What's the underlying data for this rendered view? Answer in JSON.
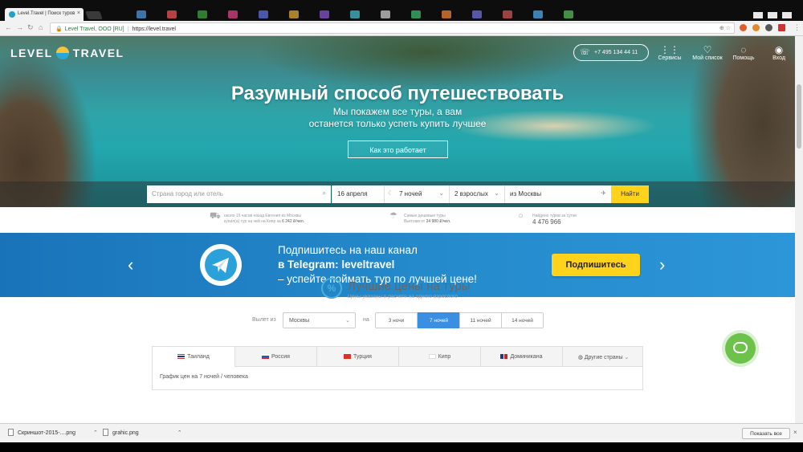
{
  "browser": {
    "tab_title": "Level.Travel | Поиск туров",
    "tab_close": "×",
    "org_name": "Level Travel, OOO [RU]",
    "url": "https://level.travel"
  },
  "header": {
    "logo_left": "LEVEL",
    "logo_right": "TRAVEL",
    "phone": "+7 495 134 44 11",
    "nav": [
      {
        "label": "Сервисы",
        "icon": "grid-icon"
      },
      {
        "label": "Мой список",
        "icon": "heart-icon"
      },
      {
        "label": "Помощь",
        "icon": "bulb-icon"
      },
      {
        "label": "Вход",
        "icon": "user-icon"
      }
    ]
  },
  "hero": {
    "title": "Разумный способ путешествовать",
    "subtitle_line1": "Мы покажем все туры, а вам",
    "subtitle_line2": "останется только успеть купить лучшее",
    "how_button": "Как это работает"
  },
  "search": {
    "destination_placeholder": "Страна город или отель",
    "date": "16 апреля",
    "nights": "7 ночей",
    "travelers": "2 взрослых",
    "from": "из Москвы",
    "find_button": "Найти"
  },
  "stats": [
    {
      "line1": "около 15 часов назад Евгения из Москвы",
      "line2": "купил(а) тур на чей на Кипр за",
      "value": "6 242 ₽/чел."
    },
    {
      "line1": "Самые дешевые туры",
      "line2": "Вьетнам от",
      "value": "24 980 ₽/чел."
    },
    {
      "line1": "Найдено туров за сутки",
      "line2": "",
      "value": "4 476 966"
    }
  ],
  "telegram": {
    "line1": "Подпишитесь на наш канал",
    "line2": "в Telegram: leveltravel",
    "line3": "– успейте поймать тур по лучшей цене!",
    "button": "Подпишитесь",
    "prev": "‹",
    "next": "›"
  },
  "best_prices": {
    "icon_glyph": "%",
    "title": "Лучшие цены на туры",
    "subtitle": "Цены указаны в расчете на одного взрослого",
    "from_label": "Вылет из",
    "from_value": "Москвы",
    "on_label": "на",
    "nights_options": [
      "3 ночи",
      "7 ночей",
      "11 ночей",
      "14 ночей"
    ],
    "active_nights": "7 ночей",
    "countries": [
      "Таиланд",
      "Россия",
      "Турция",
      "Кипр",
      "Доминикана",
      "Другие страны"
    ],
    "chart_caption": "График цен на 7 ночей / человека"
  },
  "downloads": {
    "items": [
      "Скриншот-2015-....png",
      "grahic.png"
    ],
    "show_all": "Показать все",
    "close": "×"
  },
  "colors": {
    "accent_yellow": "#ffd21c",
    "telegram_blue": "#2389cb",
    "active_tab_blue": "#3b8fe3",
    "chat_green": "#6cc24a"
  }
}
